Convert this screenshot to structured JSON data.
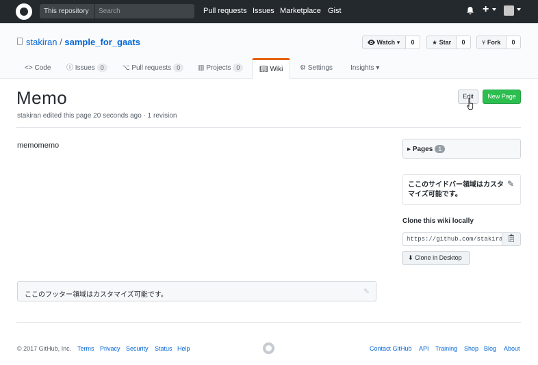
{
  "header": {
    "search_scope": "This repository",
    "search_placeholder": "Search",
    "nav": [
      "Pull requests",
      "Issues",
      "Marketplace",
      "Gist"
    ],
    "plus": "+"
  },
  "repo": {
    "owner": "stakiran",
    "separator": "/",
    "name": "sample_for_gaats",
    "watch_label": "Watch",
    "watch_count": "0",
    "star_label": "Star",
    "star_count": "0",
    "fork_label": "Fork",
    "fork_count": "0"
  },
  "tabs": [
    {
      "label": "Code",
      "icon": "code-icon"
    },
    {
      "label": "Issues",
      "count": "0",
      "icon": "issue-icon"
    },
    {
      "label": "Pull requests",
      "count": "0",
      "icon": "pr-icon"
    },
    {
      "label": "Projects",
      "count": "0",
      "icon": "project-icon"
    },
    {
      "label": "Wiki",
      "icon": "book-icon",
      "selected": true
    },
    {
      "label": "Settings",
      "icon": "gear-icon"
    },
    {
      "label": "Insights",
      "icon": "caret-icon"
    }
  ],
  "page": {
    "title": "Memo",
    "meta": "stakiran edited this page 20 seconds ago · 1 revision",
    "edit_label": "Edit",
    "new_page_label": "New Page",
    "content": "memomemo",
    "footer_text": "ここのフッター領域はカスタマイズ可能です。"
  },
  "sidebar": {
    "pages_label": "Pages",
    "pages_count": "1",
    "custom_text": "ここのサイドバー領域はカスタマイズ可能です。",
    "clone_title": "Clone this wiki locally",
    "clone_url": "https://github.com/stakiran/sample_for_gaats.wiki.git",
    "desktop_label": "Clone in Desktop"
  },
  "footer": {
    "copyright": "© 2017 GitHub, Inc.",
    "left_links": [
      "Terms",
      "Privacy",
      "Security",
      "Status",
      "Help"
    ],
    "right_links": [
      "Contact GitHub",
      "API",
      "Training",
      "Shop",
      "Blog",
      "About"
    ]
  },
  "colors": {
    "header_bg": "#24292e",
    "link": "#0366d6",
    "green_button": "#2cbe4e",
    "selected_tab_accent": "#e36209"
  }
}
